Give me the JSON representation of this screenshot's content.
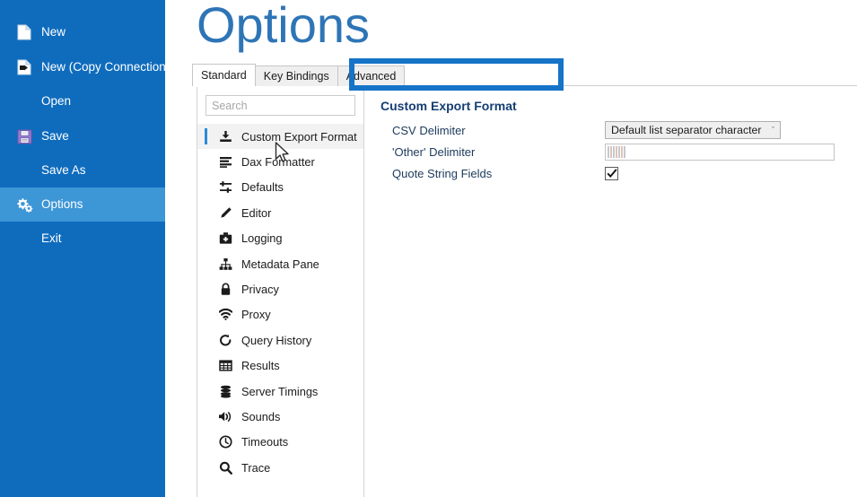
{
  "backstage": {
    "items": [
      {
        "label": "New",
        "icon": "new-document-icon",
        "selected": false,
        "has_icon": true
      },
      {
        "label": "New (Copy Connection)",
        "icon": "new-copy-connection-icon",
        "selected": false,
        "has_icon": true
      },
      {
        "label": "Open",
        "icon": "",
        "selected": false,
        "has_icon": false
      },
      {
        "label": "Save",
        "icon": "save-floppy-icon",
        "selected": false,
        "has_icon": true
      },
      {
        "label": "Save As",
        "icon": "",
        "selected": false,
        "has_icon": false
      },
      {
        "label": "Options",
        "icon": "gears-icon",
        "selected": true,
        "has_icon": true
      },
      {
        "label": "Exit",
        "icon": "",
        "selected": false,
        "has_icon": false
      }
    ],
    "background_color": "#0f6cbd",
    "selected_color": "#3d96d6"
  },
  "header": {
    "title": "Options",
    "title_color": "#2e75b6"
  },
  "tabs": [
    {
      "label": "Standard",
      "active": true
    },
    {
      "label": "Key Bindings",
      "active": false
    },
    {
      "label": "Advanced",
      "active": false
    }
  ],
  "annotation": {
    "name": "tabs-highlight-box",
    "color": "#1574c8"
  },
  "search": {
    "value": "",
    "placeholder": "Search"
  },
  "options_list": [
    {
      "label": "Custom Export Format",
      "icon": "export-download-icon",
      "selected": true
    },
    {
      "label": "Dax Formatter",
      "icon": "format-lines-icon",
      "selected": false
    },
    {
      "label": "Defaults",
      "icon": "sliders-icon",
      "selected": false
    },
    {
      "label": "Editor",
      "icon": "pencil-icon",
      "selected": false
    },
    {
      "label": "Logging",
      "icon": "medical-kit-icon",
      "selected": false
    },
    {
      "label": "Metadata Pane",
      "icon": "hierarchy-icon",
      "selected": false
    },
    {
      "label": "Privacy",
      "icon": "lock-icon",
      "selected": false
    },
    {
      "label": "Proxy",
      "icon": "wifi-icon",
      "selected": false
    },
    {
      "label": "Query History",
      "icon": "history-clock-icon",
      "selected": false
    },
    {
      "label": "Results",
      "icon": "grid-table-icon",
      "selected": false
    },
    {
      "label": "Server Timings",
      "icon": "database-icon",
      "selected": false
    },
    {
      "label": "Sounds",
      "icon": "speaker-icon",
      "selected": false
    },
    {
      "label": "Timeouts",
      "icon": "clock-icon",
      "selected": false
    },
    {
      "label": "Trace",
      "icon": "magnifier-icon",
      "selected": false
    }
  ],
  "detail": {
    "heading": "Custom Export Format",
    "heading_color": "#153e73",
    "fields": [
      {
        "label": "CSV Delimiter",
        "type": "dropdown",
        "value": "Default list separator character",
        "caret": "ˇ"
      },
      {
        "label": "'Other' Delimiter",
        "type": "text",
        "value": "",
        "placeholder": ""
      },
      {
        "label": "Quote String Fields",
        "type": "checkbox",
        "checked": true
      }
    ]
  }
}
